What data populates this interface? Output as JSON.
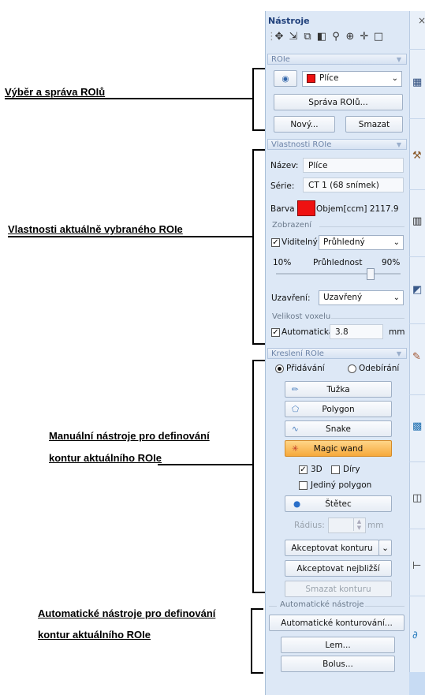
{
  "annotations": {
    "roi_selection": "Výběr a správa ROIů",
    "roi_properties": "Vlastnosti aktuálně vybraného ROIe",
    "manual_tools_line1": "Manuální nástroje pro definování",
    "manual_tools_line2": "kontur aktuálního ROIe",
    "auto_tools_line1": "Automatické nástroje pro definování",
    "auto_tools_line2": "kontur aktuálního ROIe"
  },
  "panel": {
    "title": "Nástroje",
    "close_label": "×"
  },
  "toolbar": {
    "icons": [
      "pointer-icon",
      "move-points-icon",
      "copy-icon",
      "window-level-icon",
      "zoom-icon",
      "zoom-region-icon",
      "pan-icon",
      "measure-icon"
    ]
  },
  "rois": {
    "header": "ROIe",
    "selected_roi": "Plíce",
    "selected_color": "#ee1111",
    "manage_button": "Správa ROIů...",
    "new_button": "Nový...",
    "delete_button": "Smazat"
  },
  "properties": {
    "header": "Vlastnosti ROIe",
    "name_label": "Název:",
    "name_value": "Plíce",
    "series_label": "Série:",
    "series_value": "CT 1 (68 snímek)",
    "color_label": "Barva",
    "color_value": "#ee1111",
    "volume_text": "Objem[ccm] 2117.9",
    "display_group": "Zobrazení",
    "visible_label": "Viditelný",
    "visible_checked": true,
    "display_mode": "Průhledný",
    "transparency_min": "10%",
    "transparency_label": "Průhlednost",
    "transparency_max": "90%",
    "transparency_fraction": 0.75,
    "closure_label": "Uzavření:",
    "closure_value": "Uzavřený",
    "voxel_group": "Velikost voxelu",
    "auto_label": "Automatická",
    "auto_checked": true,
    "voxel_value": "3.8",
    "voxel_unit": "mm"
  },
  "drawing": {
    "header": "Kreslení ROIe",
    "mode_add": "Přidávání",
    "mode_remove": "Odebírání",
    "selected_mode": "add",
    "pencil_button": "Tužka",
    "polygon_button": "Polygon",
    "snake_button": "Snake",
    "magic_wand_button": "Magic wand",
    "three_d_label": "3D",
    "three_d_checked": true,
    "holes_label": "Díry",
    "holes_checked": false,
    "single_polygon_label": "Jediný polygon",
    "single_polygon_checked": false,
    "brush_button": "Štětec",
    "radius_label": "Rádius:",
    "radius_unit": "mm",
    "accept_contour_button": "Akceptovat konturu",
    "accept_nearest_button": "Akceptovat nejbližší",
    "delete_contour_button": "Smazat konturu"
  },
  "automatic": {
    "group": "Automatické nástroje",
    "auto_contour_button": "Automatické konturování...",
    "rim_button": "Lem...",
    "bolus_button": "Bolus..."
  },
  "side_tabs": {
    "icons": [
      "structures-icon",
      "tools-icon",
      "layout-icon",
      "plane-icon",
      "paint-icon",
      "image-icon",
      "cube-icon",
      "ruler-icon",
      "contour-icon"
    ]
  }
}
